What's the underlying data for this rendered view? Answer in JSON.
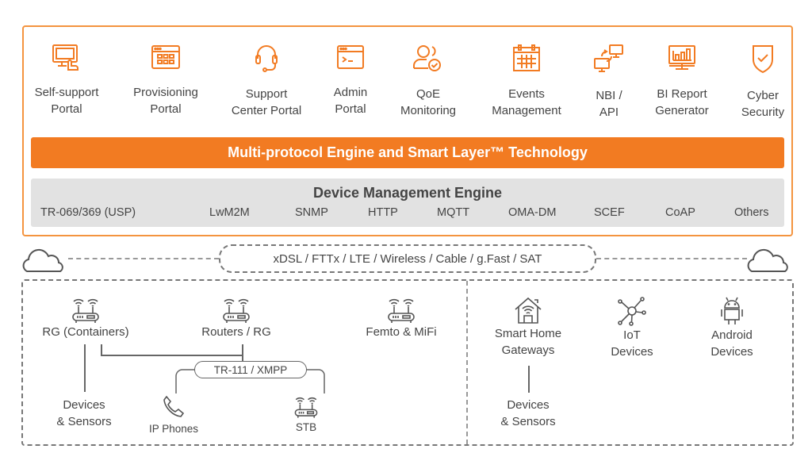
{
  "colors": {
    "accent": "#f27b22",
    "accent_border": "#f4943f",
    "engine_panel": "#e2e2e2",
    "text": "#444444",
    "icon_gray": "#555555"
  },
  "apps": [
    {
      "icon": "touch-monitor-icon",
      "line1": "Self-support",
      "line2": "Portal"
    },
    {
      "icon": "browser-grid-icon",
      "line1": "Provisioning",
      "line2": "Portal"
    },
    {
      "icon": "headset-icon",
      "line1": "Support",
      "line2": "Center Portal"
    },
    {
      "icon": "terminal-window-icon",
      "line1": "Admin",
      "line2": "Portal"
    },
    {
      "icon": "user-check-icon",
      "line1": "QoE",
      "line2": "Monitoring"
    },
    {
      "icon": "calendar-icon",
      "line1": "Events",
      "line2": "Management"
    },
    {
      "icon": "sync-monitors-icon",
      "line1": "NBI /",
      "line2": "API"
    },
    {
      "icon": "bar-chart-monitor-icon",
      "line1": "BI Report",
      "line2": "Generator"
    },
    {
      "icon": "shield-check-icon",
      "line1": "Cyber",
      "line2": "Security"
    }
  ],
  "engine_bar": "Multi-protocol Engine and Smart Layer™ Technology",
  "device_management": {
    "title": "Device Management Engine",
    "protocols": [
      "TR-069/369 (USP)",
      "LwM2M",
      "SNMP",
      "HTTP",
      "MQTT",
      "OMA-DM",
      "SCEF",
      "CoAP",
      "Others"
    ]
  },
  "network": {
    "label": "xDSL / FTTx / LTE / Wireless / Cable / g.Fast / SAT",
    "left_icon": "cloud-icon",
    "right_icon": "cloud-icon"
  },
  "left_group": {
    "rg_containers": "RG (Containers)",
    "routers_rg": "Routers / RG",
    "femto_mifi": "Femto & MiFi",
    "devices_sensors_line1": "Devices",
    "devices_sensors_line2": "& Sensors",
    "tr111": "TR-111 / XMPP",
    "ip_phones": "IP Phones",
    "stb": "STB"
  },
  "right_group": {
    "smart_home_line1": "Smart Home",
    "smart_home_line2": "Gateways",
    "iot_line1": "IoT",
    "iot_line2": "Devices",
    "android_line1": "Android",
    "android_line2": "Devices",
    "devices_sensors_line1": "Devices",
    "devices_sensors_line2": "& Sensors"
  }
}
